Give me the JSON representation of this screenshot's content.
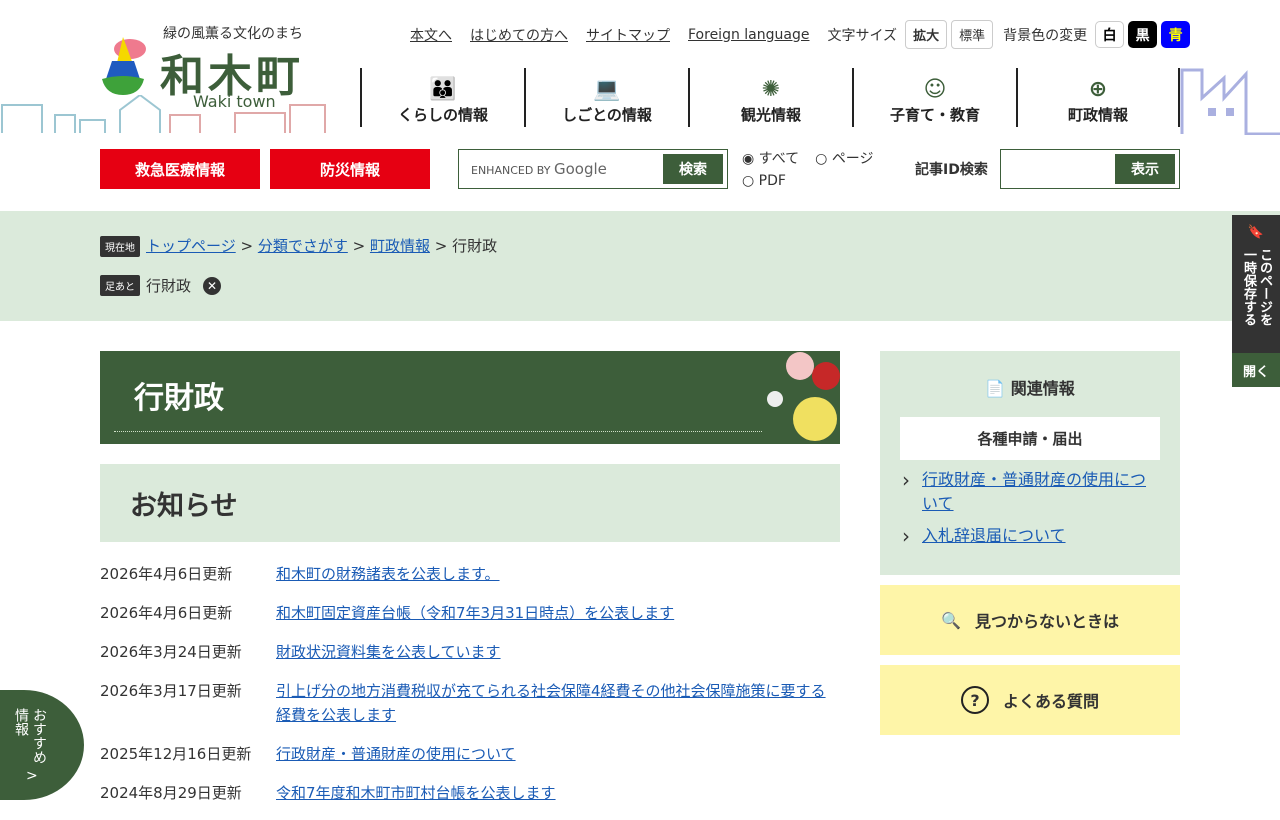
{
  "header": {
    "tagline": "緑の風薫る文化のまち",
    "name": "和木町",
    "name_en": "Waki town"
  },
  "util": {
    "links": [
      "本文へ",
      "はじめての方へ",
      "サイトマップ",
      "Foreign language"
    ],
    "font_size_label": "文字サイズ",
    "font_large": "拡大",
    "font_normal": "標準",
    "bg_label": "背景色の変更",
    "bg_white": "白",
    "bg_black": "黒",
    "bg_blue": "青"
  },
  "gnav": [
    {
      "label": "くらしの情報",
      "icon": "family-icon"
    },
    {
      "label": "しごとの情報",
      "icon": "work-icon"
    },
    {
      "label": "観光情報",
      "icon": "fireworks-icon"
    },
    {
      "label": "子育て・教育",
      "icon": "child-face-icon"
    },
    {
      "label": "町政情報",
      "icon": "town-emblem-icon"
    }
  ],
  "emergency": "救急医療情報",
  "disaster": "防災情報",
  "search": {
    "enhanced": "ENHANCED BY",
    "google": "Google",
    "button": "検索",
    "opt_all": "すべて",
    "opt_page": "ページ",
    "opt_pdf": "PDF",
    "id_label": "記事ID検索",
    "id_button": "表示"
  },
  "breadcrumb": {
    "tag": "現在地",
    "items": [
      "トップページ",
      "分類でさがす",
      "町政情報"
    ],
    "current": "行財政",
    "sep": " > "
  },
  "footprint": {
    "tag": "足あと",
    "item": "行財政"
  },
  "side": {
    "col1": "このページを",
    "col2": "一時保存する",
    "open": "開く"
  },
  "page_title": "行財政",
  "section_title": "お知らせ",
  "news": [
    {
      "date": "2026年4月6日更新",
      "title": "和木町の財務諸表を公表します。"
    },
    {
      "date": "2026年4月6日更新",
      "title": "和木町固定資産台帳（令和7年3月31日時点）を公表します"
    },
    {
      "date": "2026年3月24日更新",
      "title": "財政状況資料集を公表しています"
    },
    {
      "date": "2026年3月17日更新",
      "title": "引上げ分の地方消費税収が充てられる社会保障4経費その他社会保障施策に要する経費を公表します"
    },
    {
      "date": "2025年12月16日更新",
      "title": "行政財産・普通財産の使用について"
    },
    {
      "date": "2024年8月29日更新",
      "title": "令和7年度和木町市町村台帳を公表します"
    }
  ],
  "related": {
    "title": "関連情報",
    "subtitle": "各種申請・届出",
    "links": [
      "行政財産・普通財産の使用について",
      "入札辞退届について"
    ]
  },
  "notfound": "見つからないときは",
  "faq": "よくある質問",
  "recommend": {
    "label": "おすすめ",
    "label2": "情報",
    "arrow": ">"
  },
  "colors": {
    "green": "#3d5e3a",
    "light": "#dbeadb",
    "red": "#e60012",
    "yellow": "#fef5a8"
  }
}
